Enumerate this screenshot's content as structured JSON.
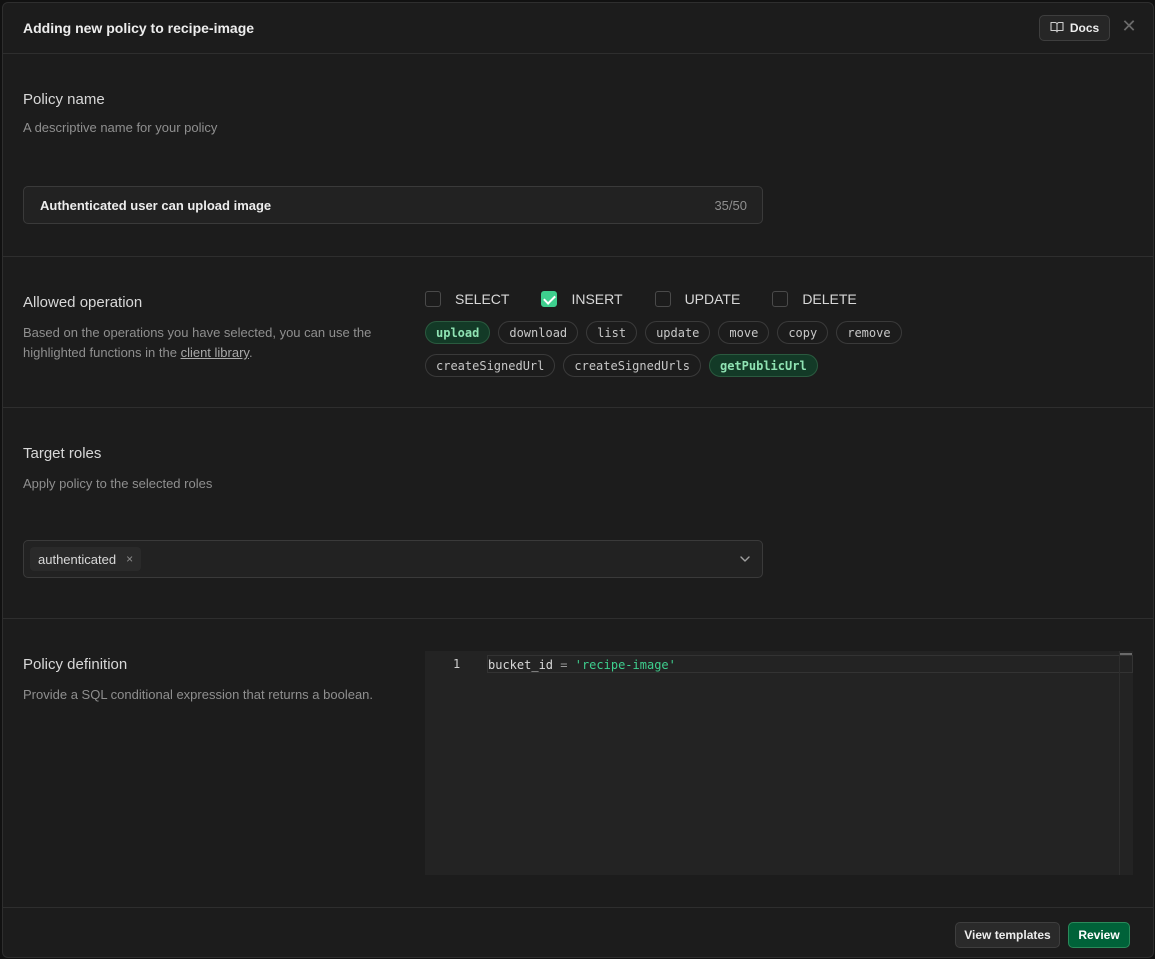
{
  "header": {
    "title": "Adding new policy to recipe-image",
    "docs_label": "Docs"
  },
  "policy_name": {
    "title": "Policy name",
    "description": "A descriptive name for your policy",
    "value": "Authenticated user can upload image",
    "counter": "35/50"
  },
  "allowed_operation": {
    "title": "Allowed operation",
    "description_before": "Based on the operations you have selected, you can use the highlighted functions in the ",
    "link": "client library",
    "description_after": ".",
    "operations": [
      {
        "label": "SELECT",
        "checked": false
      },
      {
        "label": "INSERT",
        "checked": true
      },
      {
        "label": "UPDATE",
        "checked": false
      },
      {
        "label": "DELETE",
        "checked": false
      }
    ],
    "functions": [
      {
        "label": "upload",
        "highlighted": true
      },
      {
        "label": "download",
        "highlighted": false
      },
      {
        "label": "list",
        "highlighted": false
      },
      {
        "label": "update",
        "highlighted": false
      },
      {
        "label": "move",
        "highlighted": false
      },
      {
        "label": "copy",
        "highlighted": false
      },
      {
        "label": "remove",
        "highlighted": false
      },
      {
        "label": "createSignedUrl",
        "highlighted": false
      },
      {
        "label": "createSignedUrls",
        "highlighted": false
      },
      {
        "label": "getPublicUrl",
        "highlighted": true
      }
    ]
  },
  "target_roles": {
    "title": "Target roles",
    "description": "Apply policy to the selected roles",
    "selected_role": "authenticated",
    "remove_symbol": "×"
  },
  "policy_definition": {
    "title": "Policy definition",
    "description": "Provide a SQL conditional expression that returns a boolean.",
    "line_number": "1",
    "code_identifier": "bucket_id",
    "code_operator": " = ",
    "code_string": "'recipe-image'"
  },
  "footer": {
    "secondary_label": "View templates",
    "primary_label": "Review"
  },
  "colors": {
    "accent": "#3ecf8e",
    "primary_button": "#006239",
    "background": "#1c1c1c"
  }
}
